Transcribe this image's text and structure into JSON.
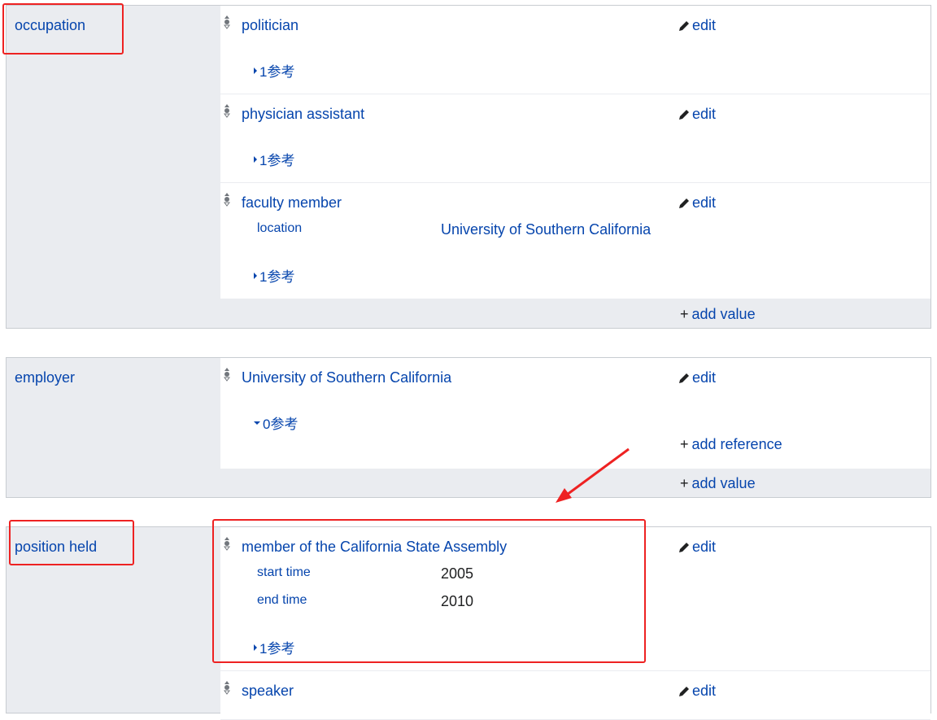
{
  "edit_label": "edit",
  "add_value_label": "add value",
  "add_reference_label": "add reference",
  "occupation": {
    "label": "occupation",
    "statements": [
      {
        "value": "politician",
        "refs": "1参考"
      },
      {
        "value": "physician assistant",
        "refs": "1参考"
      },
      {
        "value": "faculty member",
        "qualifier_prop": "location",
        "qualifier_value": "University of Southern California",
        "refs": "1参考"
      }
    ]
  },
  "employer": {
    "label": "employer",
    "statements": [
      {
        "value": "University of Southern California",
        "refs": "0参考"
      }
    ]
  },
  "position_held": {
    "label": "position held",
    "statements": [
      {
        "value": "member of the California State Assembly",
        "qualifiers": [
          {
            "prop": "start time",
            "value": "2005"
          },
          {
            "prop": "end time",
            "value": "2010"
          }
        ],
        "refs": "1参考"
      },
      {
        "value": "speaker"
      }
    ]
  },
  "colors": {
    "link": "#0645ad",
    "label_bg": "#eaecf0",
    "border": "#c8ccd1",
    "annotation_red": "#ee2222"
  }
}
